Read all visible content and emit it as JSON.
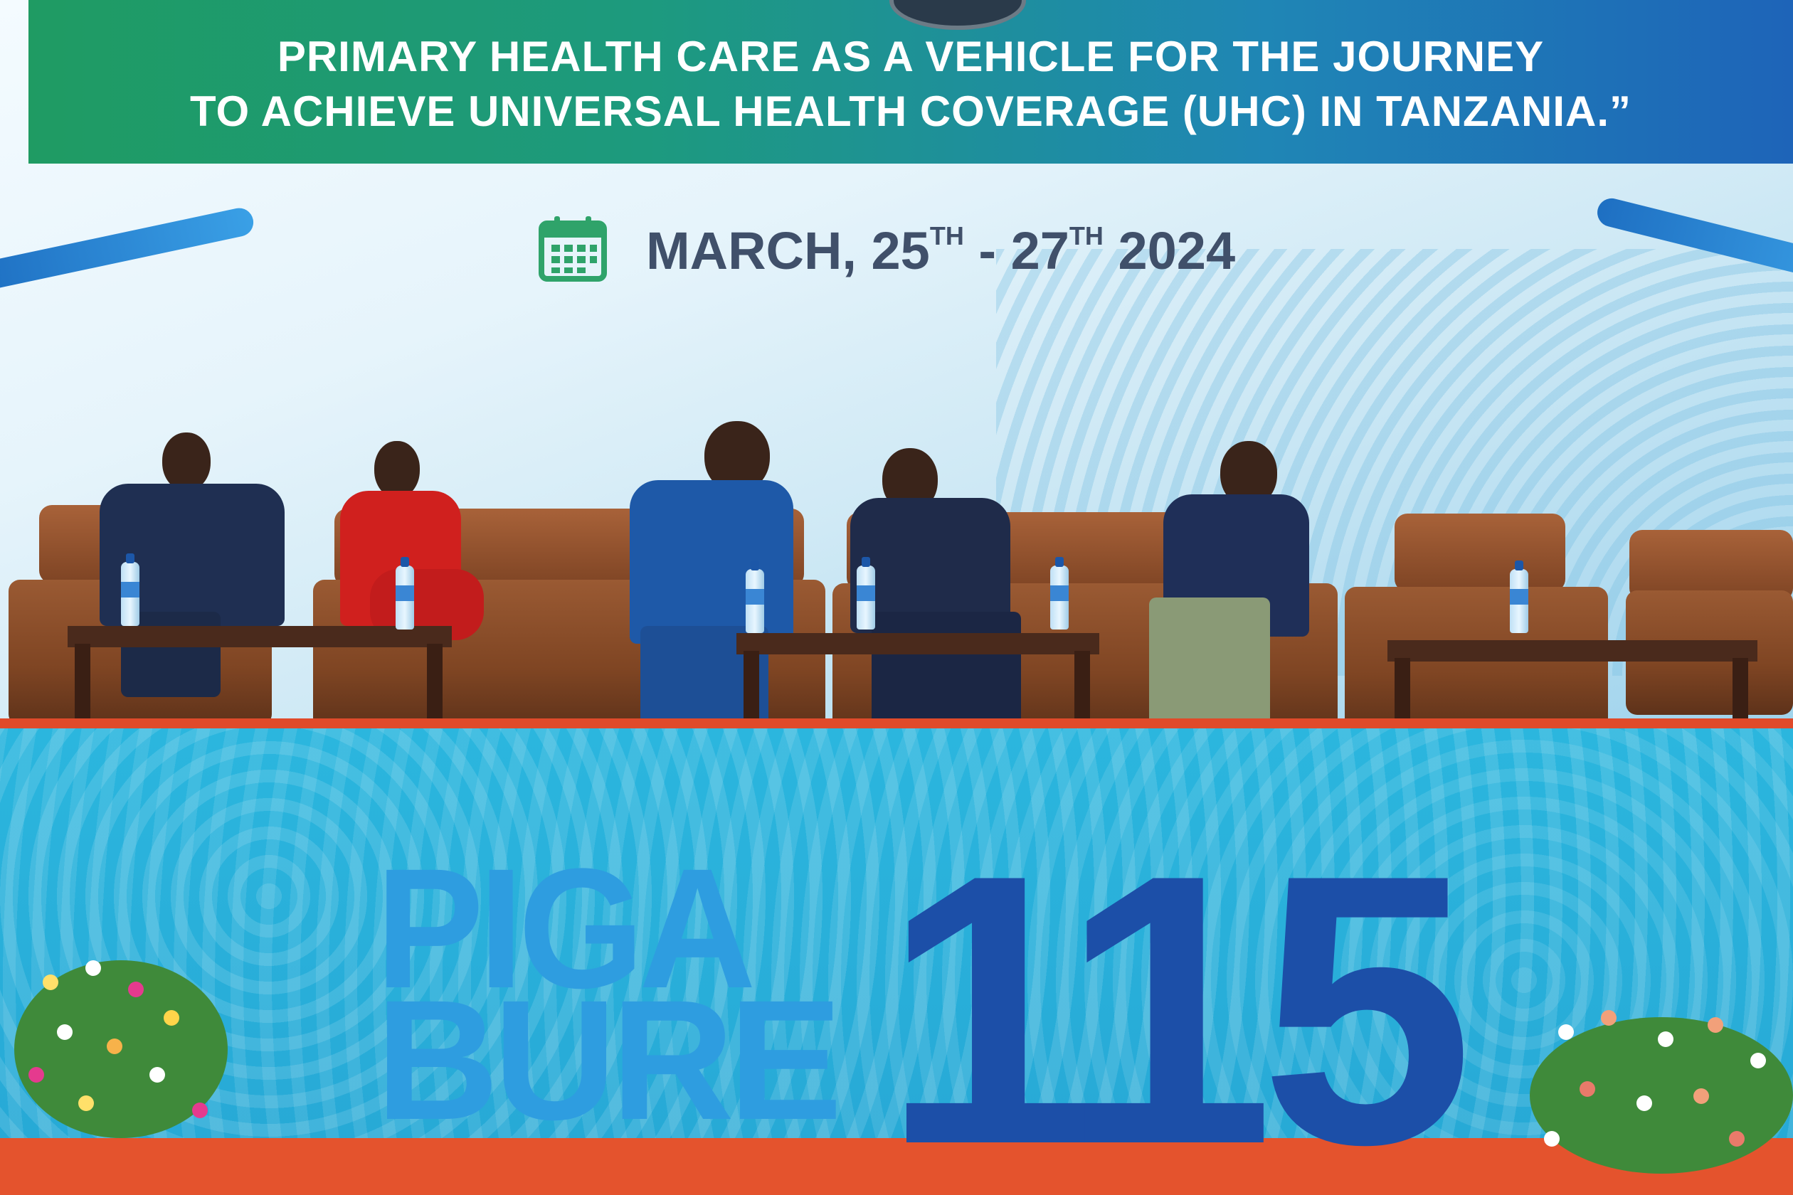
{
  "banner": {
    "title_line_1": "PRIMARY HEALTH CARE AS A VEHICLE FOR THE JOURNEY",
    "title_line_2": "TO ACHIEVE UNIVERSAL HEALTH COVERAGE (UHC) IN TANZANIA.”"
  },
  "event_date": {
    "month": "MARCH, 25",
    "start_suffix": "TH",
    "separator": " - 27",
    "end_suffix": "TH",
    "year": " 2024"
  },
  "stage_sign": {
    "word_1": "PIGA",
    "word_2": "BURE",
    "number": "115"
  },
  "colors": {
    "banner_green": "#1f9b63",
    "banner_blue": "#1e64b8",
    "stage_cyan": "#2bb6de",
    "sign_blue": "#1c4fa8",
    "carpet_red": "#e04a2a"
  }
}
